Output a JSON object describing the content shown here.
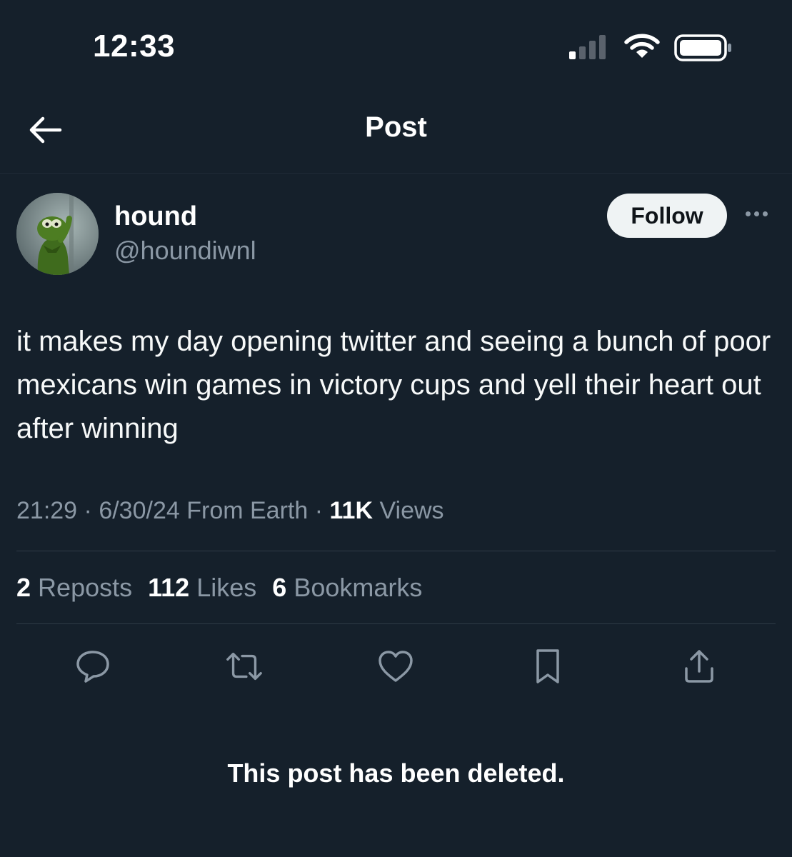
{
  "status_bar": {
    "time": "12:33"
  },
  "header": {
    "title": "Post"
  },
  "author": {
    "display_name": "hound",
    "handle": "@houndiwnl"
  },
  "follow_label": "Follow",
  "tweet": {
    "text": "it makes my day opening twitter and seeing a bunch of poor mexicans win games in victory cups and yell their heart out after winning",
    "time": "21:29",
    "date": "6/30/24",
    "source": "From Earth",
    "separator": "·",
    "views_count": "11K",
    "views_label": "Views"
  },
  "stats": {
    "reposts_count": "2",
    "reposts_label": "Reposts",
    "likes_count": "112",
    "likes_label": "Likes",
    "bookmarks_count": "6",
    "bookmarks_label": "Bookmarks"
  },
  "actions": [
    {
      "icon": "reply-icon"
    },
    {
      "icon": "repost-icon"
    },
    {
      "icon": "like-icon"
    },
    {
      "icon": "bookmark-icon"
    },
    {
      "icon": "share-icon"
    }
  ],
  "deleted_notice": "This post has been deleted.",
  "colors": {
    "background": "#15202b",
    "text_primary": "#ffffff",
    "text_secondary": "#8b98a5",
    "divider": "#2f3b47",
    "follow_button_bg": "#eff3f4"
  }
}
